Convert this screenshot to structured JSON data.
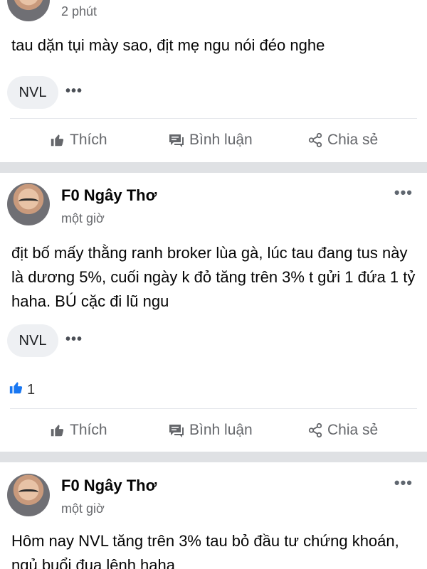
{
  "posts": [
    {
      "time": "2 phút",
      "text": "tau dặn tụi mày sao, địt mẹ ngu nói đéo nghe",
      "tag": "NVL",
      "more": "•••"
    },
    {
      "author": "F0 Ngây Thơ",
      "time": "một giờ",
      "text": "địt bố mấy thằng ranh broker lùa gà, lúc tau đang tus này là dương 5%, cuối ngày k đỏ tăng trên 3% t gửi 1 đứa 1 tỷ haha. BÚ cặc đi lũ ngu",
      "tag": "NVL",
      "more": "•••",
      "like_count": "1"
    },
    {
      "author": "F0 Ngây Thơ",
      "time": "một giờ",
      "text": "Hôm nay NVL tăng trên 3% tau bỏ đầu tư chứng khoán, ngủ buổi đua lệnh haha",
      "more": "•••"
    }
  ],
  "actions": {
    "like": "Thích",
    "comment": "Bình luận",
    "share": "Chia sẻ"
  },
  "colors": {
    "separator": "#dfe1e4",
    "action_text": "#65676b",
    "like_blue": "#1877f2"
  }
}
